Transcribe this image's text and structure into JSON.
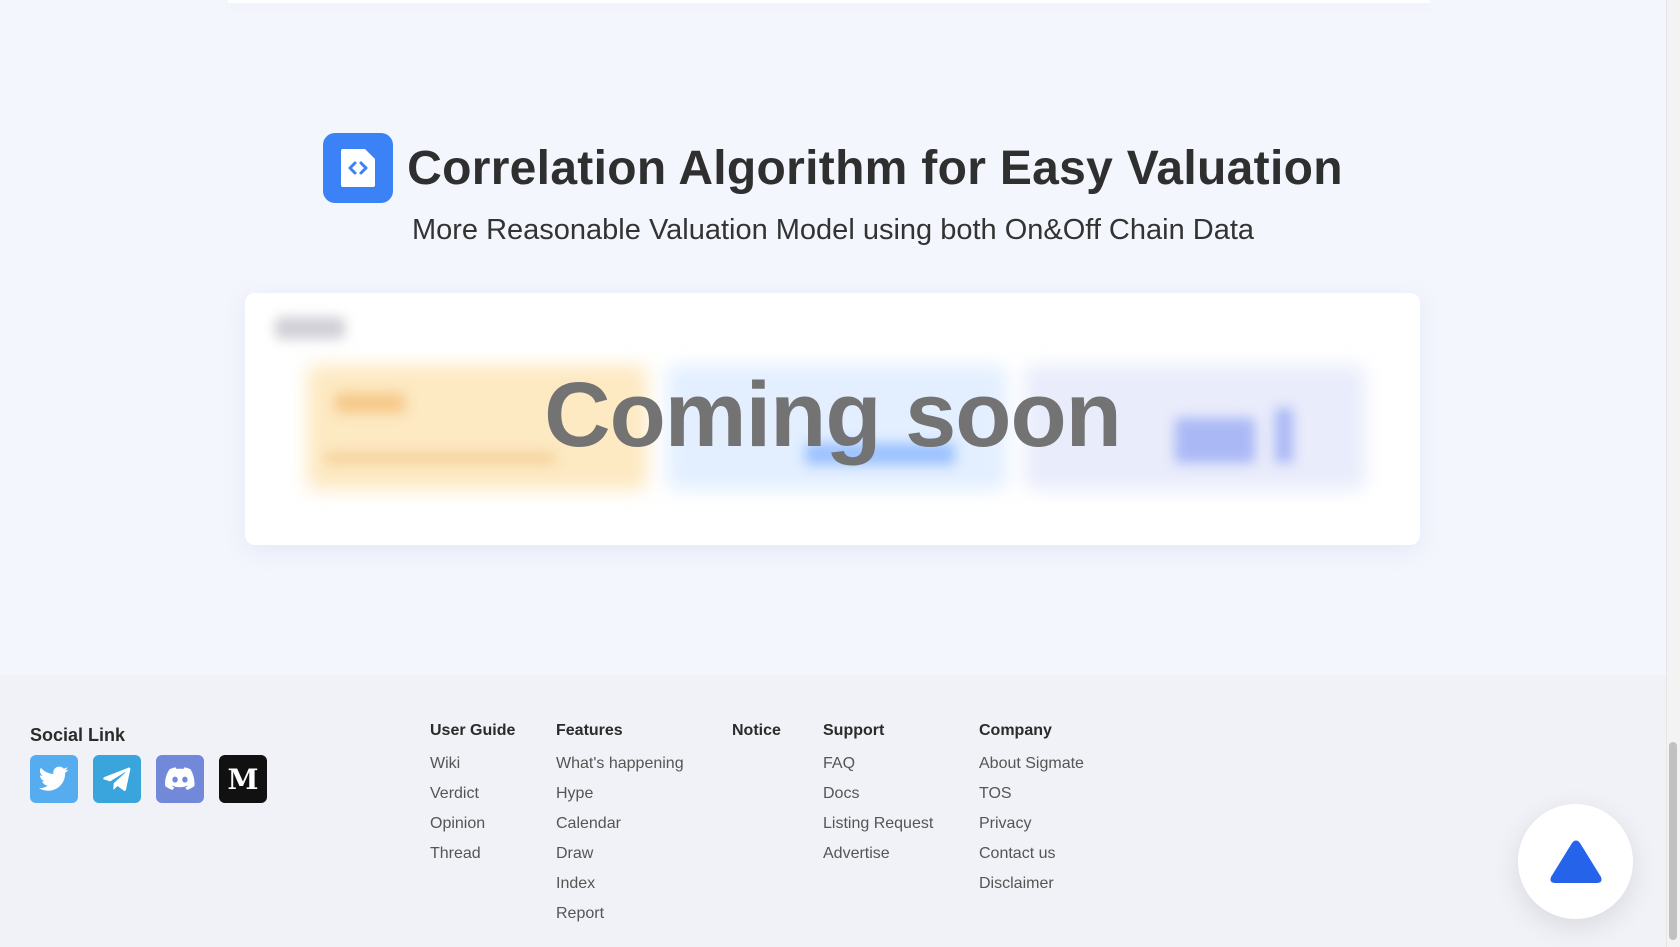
{
  "hero": {
    "title": "Correlation Algorithm for Easy Valuation",
    "subtitle": "More Reasonable Valuation Model using both On&Off Chain Data",
    "icon": "code-file-icon"
  },
  "preview_card": {
    "overlay_text": "Coming soon"
  },
  "footer": {
    "social": {
      "title": "Social Link",
      "icons": [
        "twitter-icon",
        "telegram-icon",
        "discord-icon",
        "medium-icon"
      ],
      "medium_glyph": "M"
    },
    "columns": [
      {
        "title": "User Guide",
        "links": [
          "Wiki",
          "Verdict",
          "Opinion",
          "Thread"
        ]
      },
      {
        "title": "Features",
        "links": [
          "What's happening",
          "Hype",
          "Calendar",
          "Draw",
          "Index",
          "Report"
        ]
      },
      {
        "title": "Notice",
        "links": []
      },
      {
        "title": "Support",
        "links": [
          "FAQ",
          "Docs",
          "Listing Request",
          "Advertise"
        ]
      },
      {
        "title": "Company",
        "links": [
          "About Sigmate",
          "TOS",
          "Privacy",
          "Contact us",
          "Disclaimer"
        ]
      }
    ]
  },
  "colors": {
    "accent": "#3b82f6",
    "scroll_top_arrow": "#2563eb",
    "twitter": "#55acee",
    "telegram": "#39a5dc",
    "discord": "#7289da",
    "medium": "#111111"
  }
}
